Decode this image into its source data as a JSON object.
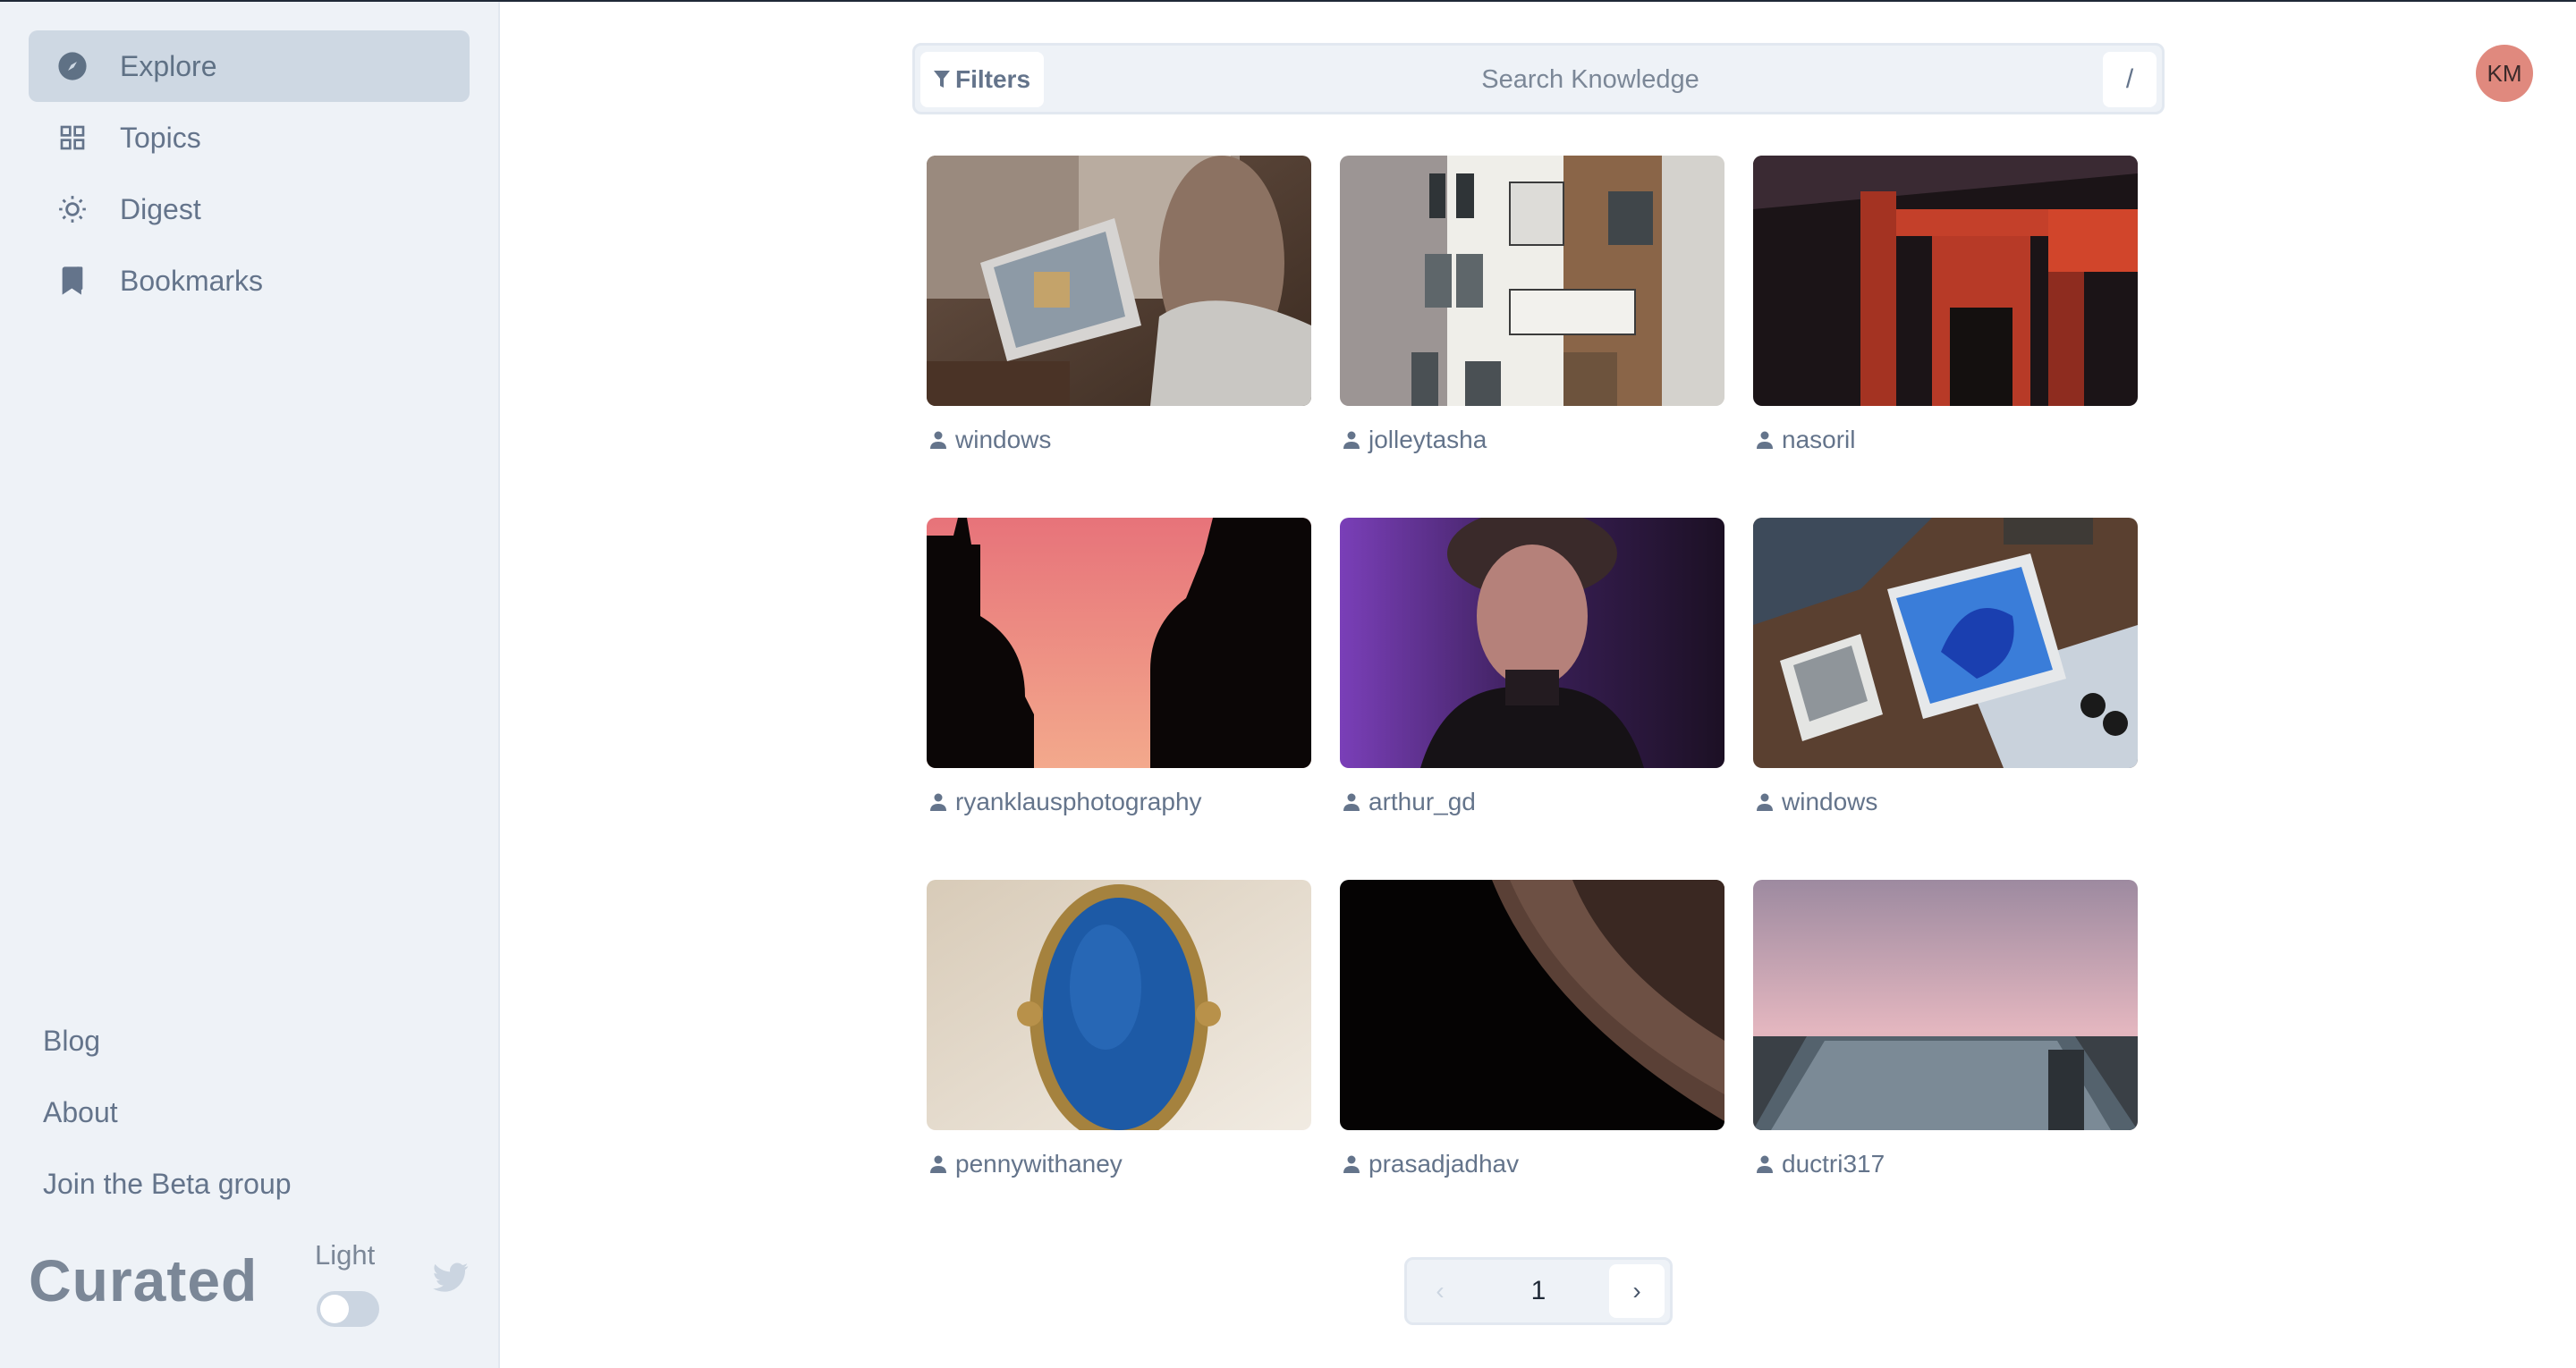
{
  "sidebar": {
    "nav": [
      {
        "label": "Explore",
        "icon": "compass-icon",
        "active": true
      },
      {
        "label": "Topics",
        "icon": "grid-icon",
        "active": false
      },
      {
        "label": "Digest",
        "icon": "sun-icon",
        "active": false
      },
      {
        "label": "Bookmarks",
        "icon": "bookmark-icon",
        "active": false
      }
    ],
    "links": [
      "Blog",
      "About",
      "Join the Beta group"
    ],
    "brand": "Curated",
    "theme_label": "Light"
  },
  "search": {
    "filters_label": "Filters",
    "placeholder": "Search Knowledge",
    "shortcut": "/"
  },
  "user": {
    "initials": "KM"
  },
  "cards": [
    {
      "author": "windows"
    },
    {
      "author": "jolleytasha"
    },
    {
      "author": "nasoril"
    },
    {
      "author": "ryanklausphotography"
    },
    {
      "author": "arthur_gd"
    },
    {
      "author": "windows"
    },
    {
      "author": "pennywithaney"
    },
    {
      "author": "prasadjadhav"
    },
    {
      "author": "ductri317"
    }
  ],
  "pagination": {
    "page": "1",
    "prev": "‹",
    "next": "›"
  },
  "colors": {
    "sidebar_bg": "#eef2f7",
    "active_bg": "#ced8e3",
    "text": "#64748b",
    "avatar": "#e0897e"
  }
}
